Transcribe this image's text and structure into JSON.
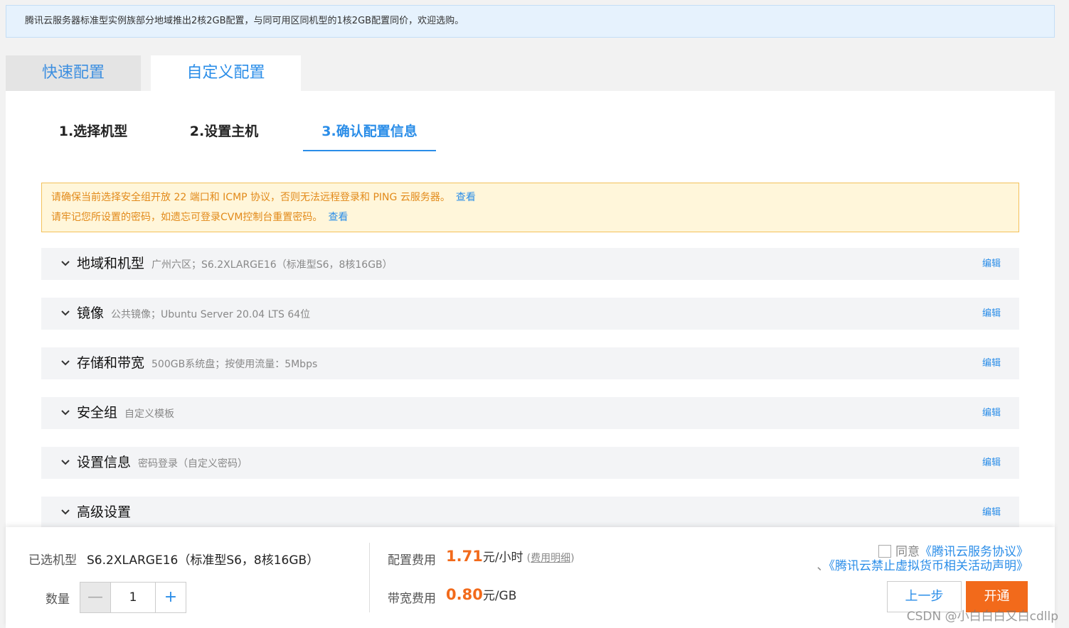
{
  "notice": {
    "text": "腾讯云服务器标准型实例族部分地域推出2核2GB配置，与同可用区同机型的1核2GB配置同价，欢迎选购。"
  },
  "main_tabs": [
    {
      "label": "快速配置",
      "active": false
    },
    {
      "label": "自定义配置",
      "active": true
    }
  ],
  "steps": [
    {
      "label": "1.选择机型",
      "active": false
    },
    {
      "label": "2.设置主机",
      "active": false
    },
    {
      "label": "3.确认配置信息",
      "active": true
    }
  ],
  "warning": {
    "line1": "请确保当前选择安全组开放 22 端口和 ICMP 协议，否则无法远程登录和 PING 云服务器。",
    "line1_link": "查看",
    "line2": "请牢记您所设置的密码，如遗忘可登录CVM控制台重置密码。",
    "line2_link": "查看"
  },
  "sections": [
    {
      "title": "地域和机型",
      "desc": "广州六区；S6.2XLARGE16（标准型S6，8核16GB）",
      "edit": "编辑"
    },
    {
      "title": "镜像",
      "desc": "公共镜像；Ubuntu Server 20.04 LTS 64位",
      "edit": "编辑"
    },
    {
      "title": "存储和带宽",
      "desc": "500GB系统盘；按使用流量：5Mbps",
      "edit": "编辑"
    },
    {
      "title": "安全组",
      "desc": "自定义模板",
      "edit": "编辑"
    },
    {
      "title": "设置信息",
      "desc": "密码登录（自定义密码）",
      "edit": "编辑"
    },
    {
      "title": "高级设置",
      "desc": "",
      "edit": "编辑"
    }
  ],
  "footer": {
    "selected_label": "已选机型",
    "selected_value": "S6.2XLARGE16（标准型S6，8核16GB）",
    "qty_label": "数量",
    "qty_minus": "—",
    "qty_value": "1",
    "qty_plus": "+",
    "config_fee_label": "配置费用",
    "config_fee_value": "1.71",
    "config_fee_unit": "元/小时",
    "fee_detail_open": "(",
    "fee_detail": "费用明细",
    "fee_detail_close": ")",
    "bandwidth_fee_label": "带宽费用",
    "bandwidth_fee_value": "0.80",
    "bandwidth_fee_unit": "元/GB",
    "agree_prefix": "同意",
    "agree_link1": "《腾讯云服务协议》",
    "agree_sep": "、",
    "agree_link2": "《腾讯云禁止虚拟货币相关活动声明》",
    "prev_button": "上一步",
    "open_button": "开通"
  },
  "watermark": "CSDN @小白白白又白cdllp",
  "colors": {
    "accent": "#2a8de8",
    "price": "#f26a1b",
    "warning_text": "#e28a1a",
    "warning_bg": "#fff6da"
  }
}
